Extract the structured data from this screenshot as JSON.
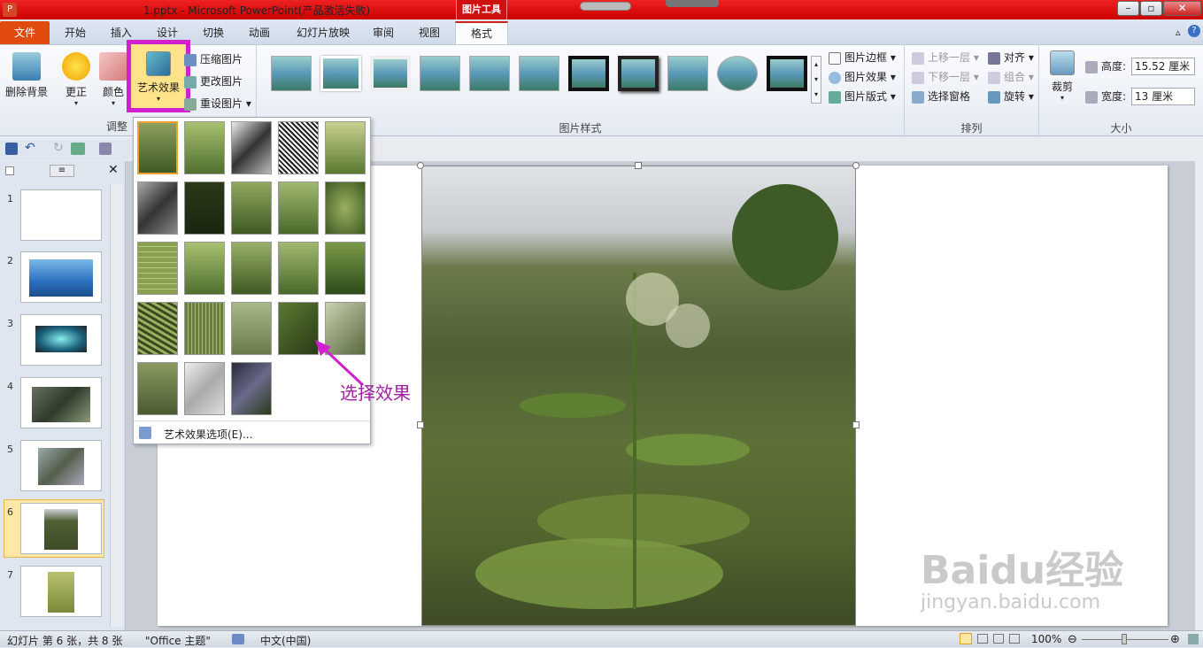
{
  "window": {
    "title": "1.pptx - Microsoft PowerPoint(产品激活失败)",
    "context_tab": "图片工具"
  },
  "tabs": [
    "文件",
    "开始",
    "插入",
    "设计",
    "切换",
    "动画",
    "幻灯片放映",
    "审阅",
    "视图",
    "格式"
  ],
  "ribbon": {
    "adjust": {
      "remove_bg": "删除背景",
      "corrections": "更正",
      "color": "颜色",
      "artistic": "艺术效果",
      "compress": "压缩图片",
      "change": "更改图片",
      "reset": "重设图片",
      "group": "调整"
    },
    "styles": {
      "group": "图片样式",
      "border": "图片边框",
      "effects": "图片效果",
      "layout": "图片版式"
    },
    "arrange": {
      "group": "排列",
      "bring_forward": "上移一层",
      "send_backward": "下移一层",
      "selection_pane": "选择窗格",
      "align": "对齐",
      "group_btn": "组合",
      "rotate": "旋转"
    },
    "size": {
      "group": "大小",
      "crop": "裁剪",
      "height_label": "高度:",
      "height": "15.52 厘米",
      "width_label": "宽度:",
      "width": "13 厘米"
    }
  },
  "gallery": {
    "options": "艺术效果选项(E)..."
  },
  "annotation": "选择效果",
  "slides": [
    "1",
    "2",
    "3",
    "4",
    "5",
    "6",
    "7"
  ],
  "status": {
    "slide": "幻灯片 第 6 张，共 8 张",
    "theme": "\"Office 主题\"",
    "lang": "中文(中国)",
    "zoom": "100%"
  },
  "watermark": {
    "brand": "Baidu经验",
    "url": "jingyan.baidu.com"
  },
  "colors": {
    "highlight": "#d020d0",
    "file_tab": "#e24b0e",
    "title_bar": "#d01010"
  }
}
